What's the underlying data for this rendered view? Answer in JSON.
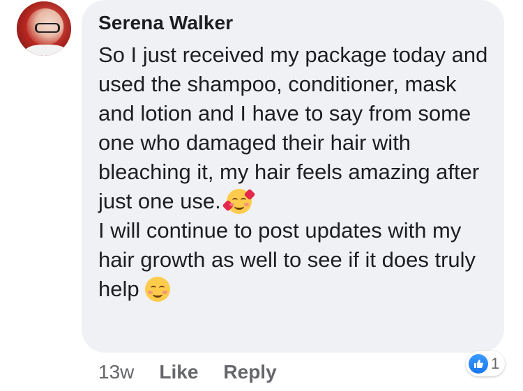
{
  "comment": {
    "author": "Serena Walker",
    "paragraphs": [
      "So I just received my package today and used the shampoo, conditioner, mask and lotion and I have to say from some one who damaged their hair with bleaching it, my hair feels amazing after just one use.",
      "I will continue to post updates with my hair growth as well to see if it does truly help"
    ],
    "emojis": [
      "smiling-face-with-hearts-icon",
      "smiling-face-icon"
    ],
    "timestamp": "13w",
    "actions": {
      "like": "Like",
      "reply": "Reply"
    },
    "reactions": {
      "type": "like-icon",
      "count": "1"
    }
  },
  "colors": {
    "bubble": "#eff1f4",
    "text": "#1c1e21",
    "meta": "#65676b",
    "like_blue": "#1877f2"
  }
}
